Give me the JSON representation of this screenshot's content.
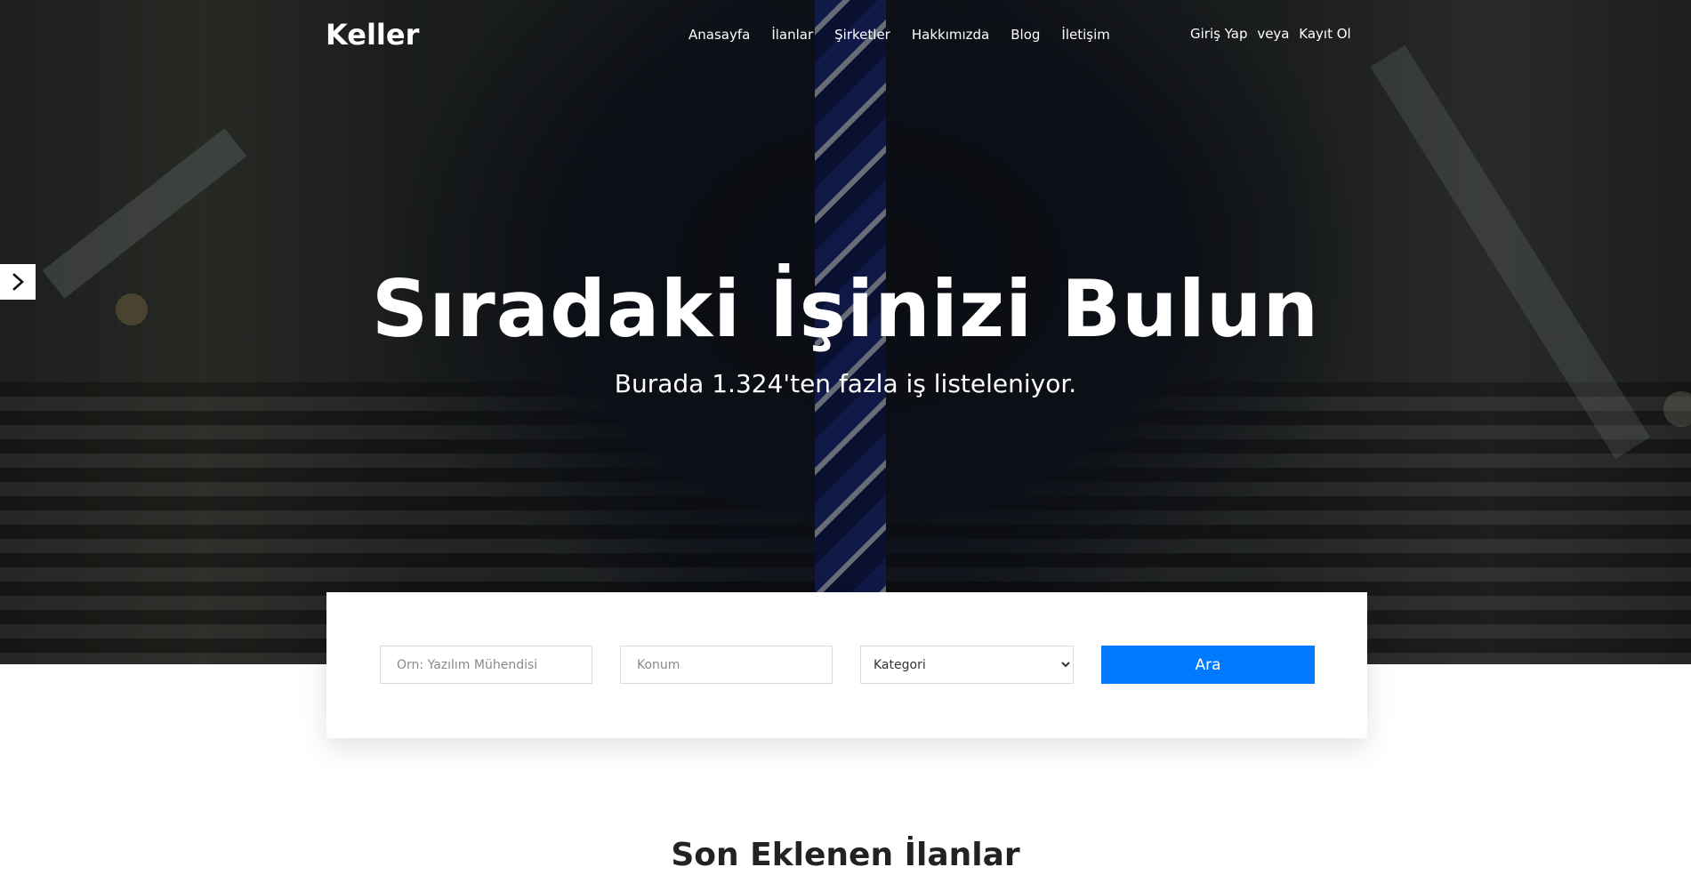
{
  "header": {
    "logo": "Keller",
    "nav": [
      "Anasayfa",
      "İlanlar",
      "Şirketler",
      "Hakkımızda",
      "Blog",
      "İletişim"
    ],
    "login": "Giriş Yap",
    "or": "veya",
    "register": "Kayıt Ol"
  },
  "hero": {
    "title": "Sıradaki İşinizi Bulun",
    "subtitle": "Burada 1.324'ten fazla iş listeleniyor."
  },
  "search": {
    "job_placeholder": "Örn: Yazılım Mühendisi",
    "location_placeholder": "Konum",
    "category_selected": "Kategori",
    "button": "Ara"
  },
  "next_section": {
    "heading": "Son Eklenen İlanlar"
  },
  "icons": {
    "slider_next": "chevron-right-icon"
  },
  "colors": {
    "accent": "#007bff"
  }
}
